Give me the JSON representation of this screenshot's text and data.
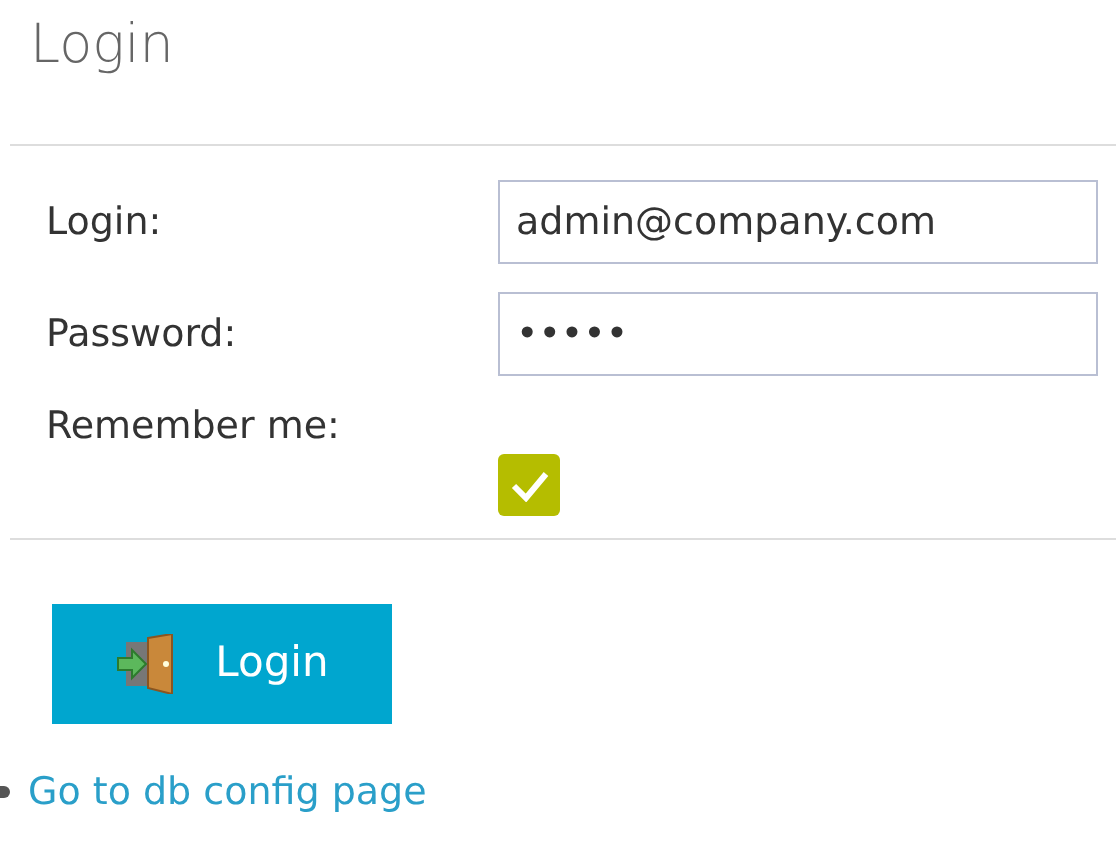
{
  "title": "Login",
  "fields": [
    {
      "label": "Login:",
      "value": "admin@company.com"
    },
    {
      "label": "Password:",
      "value": "•••••"
    }
  ],
  "remember": {
    "label": "Remember me:",
    "checked": true
  },
  "login_button": {
    "label": "Login"
  },
  "link": {
    "label": "Go to db config page"
  }
}
